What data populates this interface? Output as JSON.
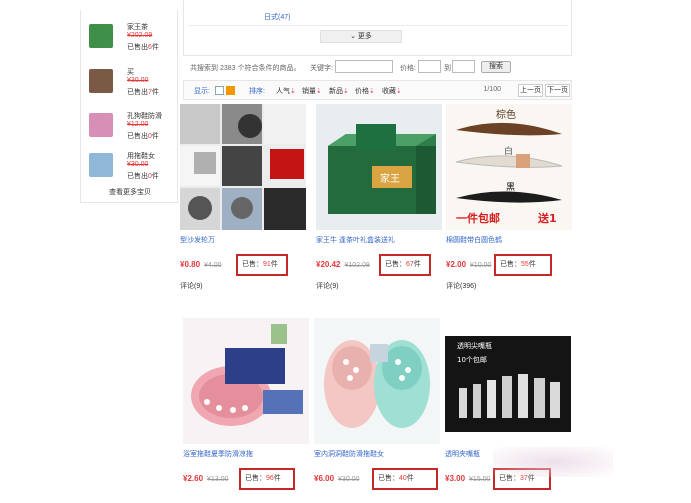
{
  "sidebar": {
    "items": [
      {
        "name": "家王茶",
        "price": "¥202.09",
        "sold_prefix": "已售出",
        "sold_count": "6",
        "sold_suffix": "件",
        "thumb_color": "#3f8f4a"
      },
      {
        "name": "买",
        "price": "¥30.00",
        "sold_prefix": "已售出",
        "sold_count": "7",
        "sold_suffix": "件",
        "thumb_color": "#7a5a44"
      },
      {
        "name": "孔狗鞋防滑",
        "price": "¥12.00",
        "sold_prefix": "已售出",
        "sold_count": "0",
        "sold_suffix": "件",
        "thumb_color": "#d88fb6"
      },
      {
        "name": "用拖鞋女",
        "price": "¥30.00",
        "sold_prefix": "已售出",
        "sold_count": "0",
        "sold_suffix": "件",
        "thumb_color": "#8fb8d8"
      }
    ],
    "more_link": "查看更多宝贝"
  },
  "filter": {
    "brand_link": "日式(47)",
    "more_button": "更多"
  },
  "search": {
    "result_text": "共搜索到 2383 个符合条件的商品。",
    "keyword_label": "关键字:",
    "price_label": "价格:",
    "to_label": "到",
    "search_button": "搜索"
  },
  "toolbar": {
    "display_label": "显示:",
    "sort_label": "排序:",
    "sort_options": [
      {
        "label": "人气",
        "arrow": "⇣"
      },
      {
        "label": "销量",
        "arrow": "⇣"
      },
      {
        "label": "新品",
        "arrow": "⇣"
      },
      {
        "label": "价格",
        "arrow": "⇣"
      },
      {
        "label": "收藏",
        "arrow": "⇣"
      }
    ],
    "page_info": "1/100",
    "prev_button": "上一页",
    "next_button": "下一页"
  },
  "products": [
    {
      "title": "型沙发轮万",
      "price": "¥0.80",
      "old_price": "¥4.00",
      "sold_prefix": "已售：",
      "sold_count": "91",
      "sold_suffix": "件",
      "review": "评论(9)"
    },
    {
      "title": "家王牛 逢茶叶礼盒装送礼",
      "price": "¥20.42",
      "old_price": "¥102.09",
      "sold_prefix": "已售：",
      "sold_count": "67",
      "sold_suffix": "件",
      "review": "评论(9)"
    },
    {
      "title": "棉圆鞋带白圆色鹤",
      "price": "¥2.00",
      "old_price": "¥10.00",
      "sold_prefix": "已售：",
      "sold_count": "55",
      "sold_suffix": "件",
      "review": "评论(396)"
    },
    {
      "title": "浴室拖鞋夏季防滑凉拖",
      "price": "¥2.60",
      "old_price": "¥13.00",
      "sold_prefix": "已售：",
      "sold_count": "96",
      "sold_suffix": "件",
      "review": ""
    },
    {
      "title": "室内洞洞鞋防滑拖鞋女",
      "price": "¥6.00",
      "old_price": "¥30.00",
      "sold_prefix": "已售：",
      "sold_count": "40",
      "sold_suffix": "件",
      "review": ""
    },
    {
      "title": "透明夹嘴瓶",
      "price": "¥3.00",
      "old_price": "¥15.00",
      "sold_prefix": "已售：",
      "sold_count": "37",
      "sold_suffix": "件",
      "review": ""
    }
  ],
  "image_text": {
    "promo_left": "一件包邮",
    "promo_right": "送1",
    "color_top": "棕色",
    "color_mid": "白",
    "color_bottom": "黑",
    "tea_brand": "家王",
    "bottle_line1": "透明尖嘴瓶",
    "bottle_line2": "10个包邮"
  }
}
